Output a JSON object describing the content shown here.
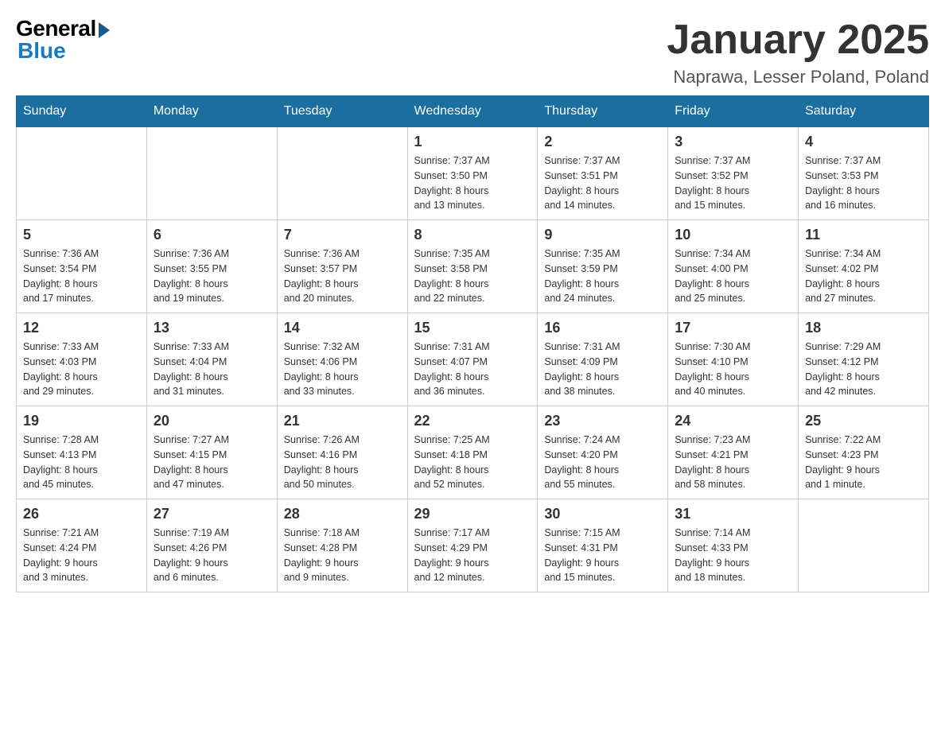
{
  "header": {
    "logo_general": "General",
    "logo_blue": "Blue",
    "month_title": "January 2025",
    "location": "Naprawa, Lesser Poland, Poland"
  },
  "weekdays": [
    "Sunday",
    "Monday",
    "Tuesday",
    "Wednesday",
    "Thursday",
    "Friday",
    "Saturday"
  ],
  "weeks": [
    [
      {
        "day": "",
        "info": ""
      },
      {
        "day": "",
        "info": ""
      },
      {
        "day": "",
        "info": ""
      },
      {
        "day": "1",
        "info": "Sunrise: 7:37 AM\nSunset: 3:50 PM\nDaylight: 8 hours\nand 13 minutes."
      },
      {
        "day": "2",
        "info": "Sunrise: 7:37 AM\nSunset: 3:51 PM\nDaylight: 8 hours\nand 14 minutes."
      },
      {
        "day": "3",
        "info": "Sunrise: 7:37 AM\nSunset: 3:52 PM\nDaylight: 8 hours\nand 15 minutes."
      },
      {
        "day": "4",
        "info": "Sunrise: 7:37 AM\nSunset: 3:53 PM\nDaylight: 8 hours\nand 16 minutes."
      }
    ],
    [
      {
        "day": "5",
        "info": "Sunrise: 7:36 AM\nSunset: 3:54 PM\nDaylight: 8 hours\nand 17 minutes."
      },
      {
        "day": "6",
        "info": "Sunrise: 7:36 AM\nSunset: 3:55 PM\nDaylight: 8 hours\nand 19 minutes."
      },
      {
        "day": "7",
        "info": "Sunrise: 7:36 AM\nSunset: 3:57 PM\nDaylight: 8 hours\nand 20 minutes."
      },
      {
        "day": "8",
        "info": "Sunrise: 7:35 AM\nSunset: 3:58 PM\nDaylight: 8 hours\nand 22 minutes."
      },
      {
        "day": "9",
        "info": "Sunrise: 7:35 AM\nSunset: 3:59 PM\nDaylight: 8 hours\nand 24 minutes."
      },
      {
        "day": "10",
        "info": "Sunrise: 7:34 AM\nSunset: 4:00 PM\nDaylight: 8 hours\nand 25 minutes."
      },
      {
        "day": "11",
        "info": "Sunrise: 7:34 AM\nSunset: 4:02 PM\nDaylight: 8 hours\nand 27 minutes."
      }
    ],
    [
      {
        "day": "12",
        "info": "Sunrise: 7:33 AM\nSunset: 4:03 PM\nDaylight: 8 hours\nand 29 minutes."
      },
      {
        "day": "13",
        "info": "Sunrise: 7:33 AM\nSunset: 4:04 PM\nDaylight: 8 hours\nand 31 minutes."
      },
      {
        "day": "14",
        "info": "Sunrise: 7:32 AM\nSunset: 4:06 PM\nDaylight: 8 hours\nand 33 minutes."
      },
      {
        "day": "15",
        "info": "Sunrise: 7:31 AM\nSunset: 4:07 PM\nDaylight: 8 hours\nand 36 minutes."
      },
      {
        "day": "16",
        "info": "Sunrise: 7:31 AM\nSunset: 4:09 PM\nDaylight: 8 hours\nand 38 minutes."
      },
      {
        "day": "17",
        "info": "Sunrise: 7:30 AM\nSunset: 4:10 PM\nDaylight: 8 hours\nand 40 minutes."
      },
      {
        "day": "18",
        "info": "Sunrise: 7:29 AM\nSunset: 4:12 PM\nDaylight: 8 hours\nand 42 minutes."
      }
    ],
    [
      {
        "day": "19",
        "info": "Sunrise: 7:28 AM\nSunset: 4:13 PM\nDaylight: 8 hours\nand 45 minutes."
      },
      {
        "day": "20",
        "info": "Sunrise: 7:27 AM\nSunset: 4:15 PM\nDaylight: 8 hours\nand 47 minutes."
      },
      {
        "day": "21",
        "info": "Sunrise: 7:26 AM\nSunset: 4:16 PM\nDaylight: 8 hours\nand 50 minutes."
      },
      {
        "day": "22",
        "info": "Sunrise: 7:25 AM\nSunset: 4:18 PM\nDaylight: 8 hours\nand 52 minutes."
      },
      {
        "day": "23",
        "info": "Sunrise: 7:24 AM\nSunset: 4:20 PM\nDaylight: 8 hours\nand 55 minutes."
      },
      {
        "day": "24",
        "info": "Sunrise: 7:23 AM\nSunset: 4:21 PM\nDaylight: 8 hours\nand 58 minutes."
      },
      {
        "day": "25",
        "info": "Sunrise: 7:22 AM\nSunset: 4:23 PM\nDaylight: 9 hours\nand 1 minute."
      }
    ],
    [
      {
        "day": "26",
        "info": "Sunrise: 7:21 AM\nSunset: 4:24 PM\nDaylight: 9 hours\nand 3 minutes."
      },
      {
        "day": "27",
        "info": "Sunrise: 7:19 AM\nSunset: 4:26 PM\nDaylight: 9 hours\nand 6 minutes."
      },
      {
        "day": "28",
        "info": "Sunrise: 7:18 AM\nSunset: 4:28 PM\nDaylight: 9 hours\nand 9 minutes."
      },
      {
        "day": "29",
        "info": "Sunrise: 7:17 AM\nSunset: 4:29 PM\nDaylight: 9 hours\nand 12 minutes."
      },
      {
        "day": "30",
        "info": "Sunrise: 7:15 AM\nSunset: 4:31 PM\nDaylight: 9 hours\nand 15 minutes."
      },
      {
        "day": "31",
        "info": "Sunrise: 7:14 AM\nSunset: 4:33 PM\nDaylight: 9 hours\nand 18 minutes."
      },
      {
        "day": "",
        "info": ""
      }
    ]
  ]
}
